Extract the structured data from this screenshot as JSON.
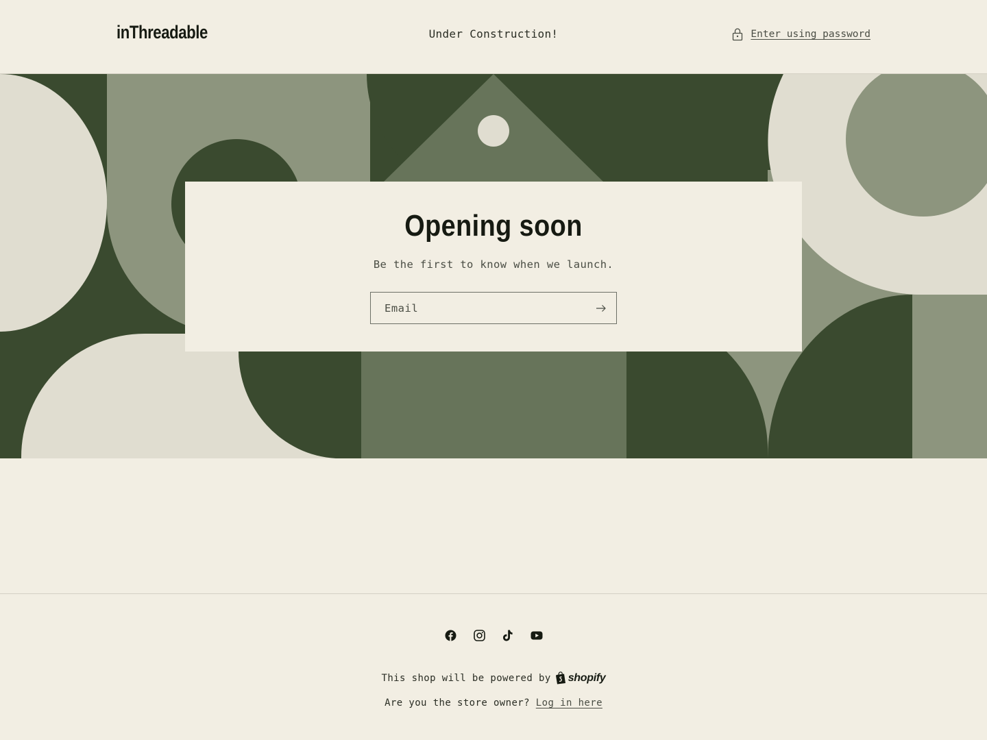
{
  "header": {
    "logo": "inThreadable",
    "announcement": "Under Construction!",
    "password_link": "Enter using password"
  },
  "card": {
    "title": "Opening soon",
    "subtitle": "Be the first to know when we launch.",
    "email_placeholder": "Email"
  },
  "footer": {
    "social_icons": [
      "facebook-icon",
      "instagram-icon",
      "tiktok-icon",
      "youtube-icon"
    ],
    "powered_text": "This shop will be powered by",
    "shopify_label": "shopify",
    "owner_text": "Are you the store owner?",
    "login_link": "Log in here"
  },
  "colors": {
    "background": "#f2eee3",
    "dark_green": "#3a4a2f",
    "sage": "#8d957e",
    "mid_green": "#67745a",
    "cream_shape": "#e0ddd0",
    "text_dark": "#161a12"
  }
}
